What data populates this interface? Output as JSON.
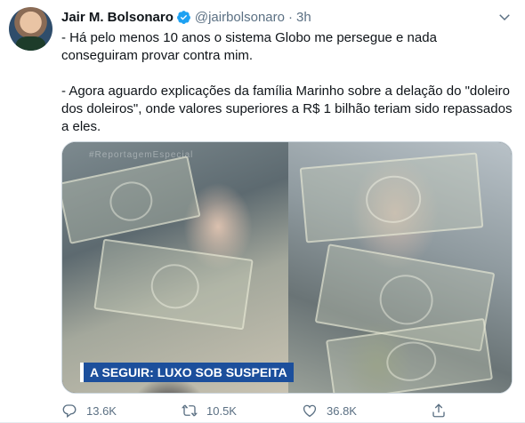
{
  "tweet": {
    "author_name": "Jair M. Bolsonaro",
    "handle": "@jairbolsonaro",
    "separator": "·",
    "time": "3h",
    "paragraph_1": "- Há pelo menos 10 anos o sistema Globo me persegue e nada conseguiram provar contra mim.",
    "paragraph_2": "- Agora aguardo explicações da família Marinho sobre a delação do \"doleiro dos doleiros\", onde valores superiores a R$ 1 bilhão teriam sido repassados a eles.",
    "media": {
      "watermark": "#ReportagemEspecial",
      "chyron": "A SEGUIR: LUXO SOB SUSPEITA"
    },
    "actions": {
      "reply_count": "13.6K",
      "retweet_count": "10.5K",
      "like_count": "36.8K"
    }
  },
  "icons": {
    "verified": "verified-badge-icon",
    "caret": "chevron-down-icon",
    "reply": "reply-icon",
    "retweet": "retweet-icon",
    "like": "heart-icon",
    "share": "share-icon"
  },
  "colors": {
    "verified_blue": "#1da1f2",
    "secondary_text": "#5b7083",
    "chyron_blue": "#1c4f9c"
  }
}
